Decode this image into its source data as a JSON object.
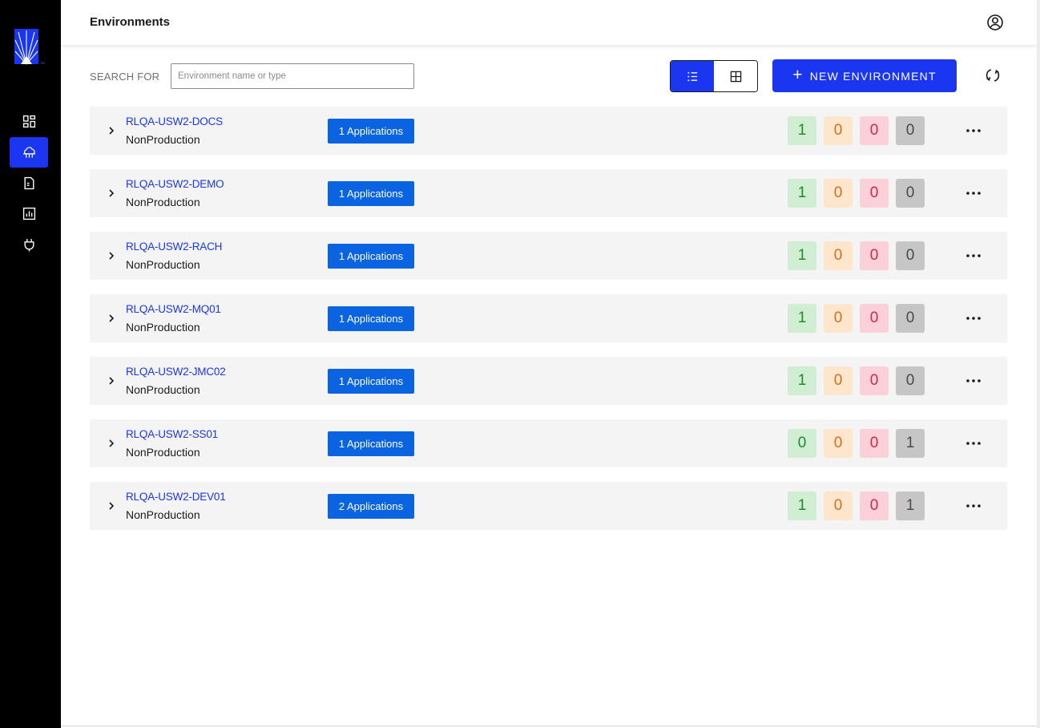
{
  "header": {
    "title": "Environments",
    "profile_icon": "user-circle-icon"
  },
  "sidebar": {
    "logo": "starburst-logo",
    "items": [
      {
        "icon": "dashboard-icon",
        "active": false
      },
      {
        "icon": "cloud-environments-icon",
        "active": true
      },
      {
        "icon": "document-icon",
        "active": false
      },
      {
        "icon": "chart-icon",
        "active": false
      },
      {
        "icon": "plug-icon",
        "active": false
      }
    ]
  },
  "toolbar": {
    "search_label": "SEARCH FOR",
    "search_placeholder": "Environment name or type",
    "search_value": "",
    "view_list_icon": "list-view-icon",
    "view_grid_icon": "grid-view-icon",
    "active_view": "list",
    "new_environment_label": "NEW ENVIRONMENT",
    "refresh_icon": "refresh-icon"
  },
  "colors": {
    "accent": "#1a36f0",
    "apps_button": "#0a63e0",
    "status_green": "#1f8a32",
    "status_orange": "#d2701a",
    "status_red": "#d0284a",
    "status_gray": "#4a4a4a"
  },
  "environments": [
    {
      "name": "RLQA-USW2-DOCS",
      "type": "NonProduction",
      "apps_label": "1 Applications",
      "counts": [
        "1",
        "0",
        "0",
        "0"
      ]
    },
    {
      "name": "RLQA-USW2-DEMO",
      "type": "NonProduction",
      "apps_label": "1 Applications",
      "counts": [
        "1",
        "0",
        "0",
        "0"
      ]
    },
    {
      "name": "RLQA-USW2-RACH",
      "type": "NonProduction",
      "apps_label": "1 Applications",
      "counts": [
        "1",
        "0",
        "0",
        "0"
      ]
    },
    {
      "name": "RLQA-USW2-MQ01",
      "type": "NonProduction",
      "apps_label": "1 Applications",
      "counts": [
        "1",
        "0",
        "0",
        "0"
      ]
    },
    {
      "name": "RLQA-USW2-JMC02",
      "type": "NonProduction",
      "apps_label": "1 Applications",
      "counts": [
        "1",
        "0",
        "0",
        "0"
      ]
    },
    {
      "name": "RLQA-USW2-SS01",
      "type": "NonProduction",
      "apps_label": "1 Applications",
      "counts": [
        "0",
        "0",
        "0",
        "1"
      ]
    },
    {
      "name": "RLQA-USW2-DEV01",
      "type": "NonProduction",
      "apps_label": "2 Applications",
      "counts": [
        "1",
        "0",
        "0",
        "1"
      ]
    }
  ]
}
